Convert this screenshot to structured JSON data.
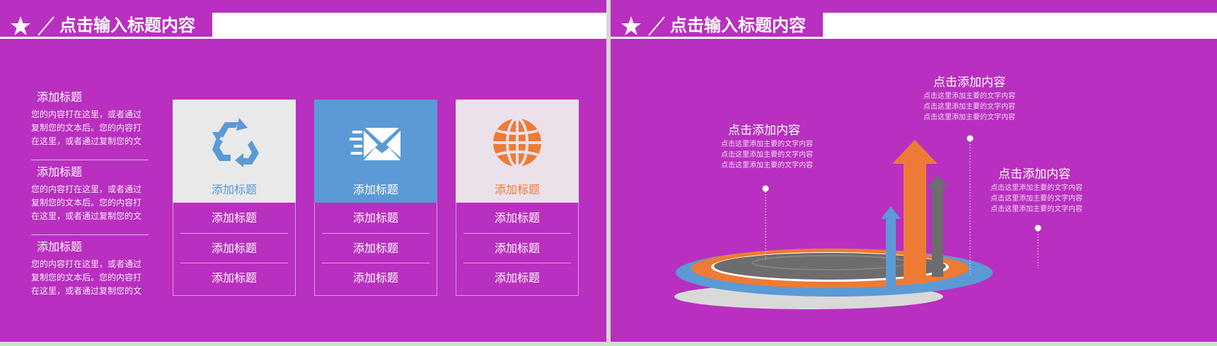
{
  "slide_left": {
    "header_title": "点击输入标题内容",
    "features": [
      {
        "title": "添加标题",
        "desc_lines": [
          "您的内容打在这里，或者通过",
          "复制您的文本后。您的内容打",
          "在这里，或者通过复制您的文"
        ]
      },
      {
        "title": "添加标题",
        "desc_lines": [
          "您的内容打在这里，或者通过",
          "复制您的文本后。您的内容打",
          "在这里，或者通过复制您的文"
        ]
      },
      {
        "title": "添加标题",
        "desc_lines": [
          "您的内容打在这里，或者通过",
          "复制您的文本后。您的内容打",
          "在这里，或者通过复制您的文"
        ]
      }
    ],
    "cards": [
      {
        "label": "添加标题",
        "icon": "recycle-icon",
        "top_color": "#e9e9ea",
        "label_color": "#5b9ad5",
        "rows": [
          "添加标题",
          "添加标题",
          "添加标题"
        ]
      },
      {
        "label": "添加标题",
        "icon": "envelope-icon",
        "top_color": "#5b9ad5",
        "label_color": "#ffffff",
        "rows": [
          "添加标题",
          "添加标题",
          "添加标题"
        ]
      },
      {
        "label": "添加标题",
        "icon": "globe-icon",
        "top_color": "#ebe1ea",
        "label_color": "#ee7b35",
        "rows": [
          "添加标题",
          "添加标题",
          "添加标题"
        ]
      }
    ]
  },
  "slide_right": {
    "header_title": "点击输入标题内容",
    "callouts": [
      {
        "title": "点击添加内容",
        "lines": [
          "点击这里添加主要的文字内容",
          "点击这里添加主要的文字内容",
          "点击这里添加主要的文字内容"
        ]
      },
      {
        "title": "点击添加内容",
        "lines": [
          "点击这里添加主要的文字内容",
          "点击这里添加主要的文字内容",
          "点击这里添加主要的文字内容"
        ]
      },
      {
        "title": "点击添加内容",
        "lines": [
          "点击这里添加主要的文字内容",
          "点击这里添加主要的文字内容",
          "点击这里添加主要的文字内容"
        ]
      }
    ]
  },
  "colors": {
    "background": "#b92fc0",
    "blue": "#5b9ad5",
    "orange": "#ee7b35",
    "gray": "#6d6c6e",
    "white": "#ffffff"
  }
}
